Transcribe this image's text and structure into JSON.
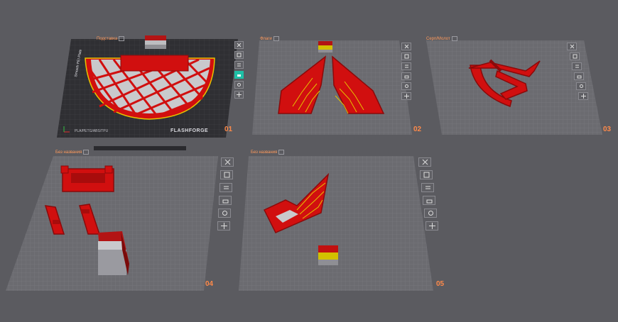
{
  "colors": {
    "background": "#5b5b60",
    "plate": "#6b6b70",
    "grid": "#7d7d82",
    "part_red": "#d10f0f",
    "part_dark_red": "#8a0a0a",
    "accent_yellow": "#e6c200",
    "active_tool": "#1fbfa6",
    "label_orange": "#ff8a4a"
  },
  "plates": [
    {
      "title": "Подставка",
      "number": "01",
      "filament": "PLA/PETG/ABS/TPU",
      "brand": "FLASHFORGE",
      "bed_text": "Smooth PEI Plate"
    },
    {
      "title": "Флаги",
      "number": "02"
    },
    {
      "title": "Серп/Молот",
      "number": "03"
    },
    {
      "title": "Без названия",
      "number": "04"
    },
    {
      "title": "Без названия",
      "number": "05"
    }
  ],
  "toolbar_icons": [
    "close-icon",
    "orient-icon",
    "arrange-icon",
    "lock-icon",
    "settings-icon",
    "move-icon"
  ]
}
